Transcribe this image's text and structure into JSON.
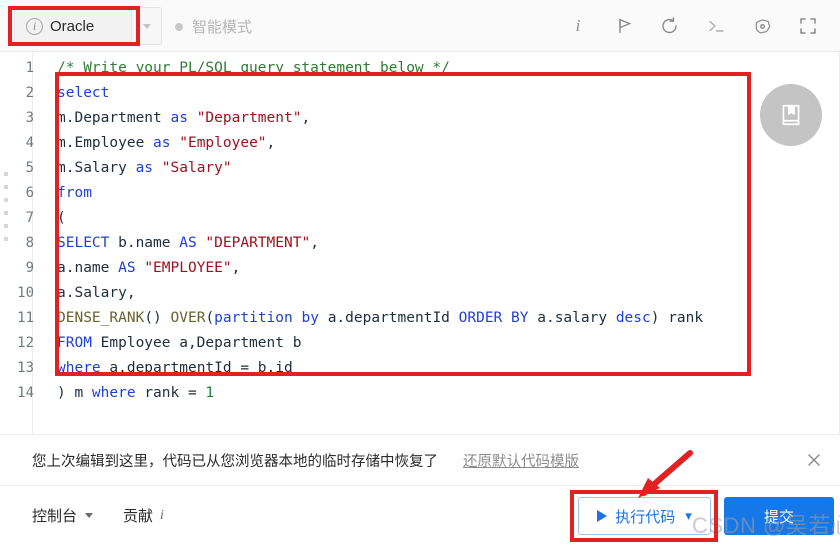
{
  "topbar": {
    "language_tab": {
      "label": "Oracle",
      "icon": "info-circle-icon"
    },
    "language_caret": "chevron-down-icon",
    "mode": {
      "label": "智能模式",
      "dot_color": "#c9c9c9"
    },
    "tools": [
      {
        "name": "info-icon",
        "glyph": "i"
      },
      {
        "name": "flag-icon",
        "glyph": "flag"
      },
      {
        "name": "reset-icon",
        "glyph": "undo"
      },
      {
        "name": "terminal-icon",
        "glyph": ">_"
      },
      {
        "name": "settings-icon",
        "glyph": "gear"
      },
      {
        "name": "fullscreen-icon",
        "glyph": "expand"
      }
    ]
  },
  "editor": {
    "save_button_icon": "book-bookmark-icon",
    "lines": [
      {
        "n": "1",
        "tokens": [
          {
            "t": "/* Write your PL/SQL query statement below */",
            "c": "cmt"
          }
        ]
      },
      {
        "n": "2",
        "tokens": [
          {
            "t": "select",
            "c": "kw"
          }
        ]
      },
      {
        "n": "3",
        "tokens": [
          {
            "t": "m.Department ",
            "c": ""
          },
          {
            "t": "as ",
            "c": "kw"
          },
          {
            "t": "\"Department\"",
            "c": "str"
          },
          {
            "t": ",",
            "c": ""
          }
        ]
      },
      {
        "n": "4",
        "tokens": [
          {
            "t": "m.Employee ",
            "c": ""
          },
          {
            "t": "as ",
            "c": "kw"
          },
          {
            "t": "\"Employee\"",
            "c": "str"
          },
          {
            "t": ",",
            "c": ""
          }
        ]
      },
      {
        "n": "5",
        "tokens": [
          {
            "t": "m.Salary ",
            "c": ""
          },
          {
            "t": "as ",
            "c": "kw"
          },
          {
            "t": "\"Salary\"",
            "c": "str"
          }
        ]
      },
      {
        "n": "6",
        "tokens": [
          {
            "t": "from",
            "c": "kw"
          }
        ]
      },
      {
        "n": "7",
        "tokens": [
          {
            "t": "(",
            "c": ""
          }
        ]
      },
      {
        "n": "8",
        "tokens": [
          {
            "t": "SELECT ",
            "c": "kw"
          },
          {
            "t": "b.name ",
            "c": ""
          },
          {
            "t": "AS ",
            "c": "kw"
          },
          {
            "t": "\"DEPARTMENT\"",
            "c": "str"
          },
          {
            "t": ",",
            "c": ""
          }
        ]
      },
      {
        "n": "9",
        "tokens": [
          {
            "t": "a.name ",
            "c": ""
          },
          {
            "t": "AS ",
            "c": "kw"
          },
          {
            "t": "\"EMPLOYEE\"",
            "c": "str"
          },
          {
            "t": ",",
            "c": ""
          }
        ]
      },
      {
        "n": "10",
        "tokens": [
          {
            "t": "a.Salary,",
            "c": ""
          }
        ]
      },
      {
        "n": "11",
        "tokens": [
          {
            "t": "DENSE_RANK",
            "c": "fn"
          },
          {
            "t": "() ",
            "c": ""
          },
          {
            "t": "OVER",
            "c": "fn"
          },
          {
            "t": "(",
            "c": ""
          },
          {
            "t": "partition ",
            "c": "kw"
          },
          {
            "t": "by ",
            "c": "kw"
          },
          {
            "t": "a.departmentId ",
            "c": ""
          },
          {
            "t": "ORDER ",
            "c": "kw"
          },
          {
            "t": "BY ",
            "c": "kw"
          },
          {
            "t": "a.salary ",
            "c": ""
          },
          {
            "t": "desc",
            "c": "kw"
          },
          {
            "t": ") rank",
            "c": ""
          }
        ]
      },
      {
        "n": "12",
        "tokens": [
          {
            "t": "FROM ",
            "c": "kw"
          },
          {
            "t": "Employee a,Department b",
            "c": ""
          }
        ]
      },
      {
        "n": "13",
        "tokens": [
          {
            "t": "where ",
            "c": "kw"
          },
          {
            "t": "a.departmentId = b.id",
            "c": ""
          }
        ]
      },
      {
        "n": "14",
        "tokens": [
          {
            "t": ") m ",
            "c": ""
          },
          {
            "t": "where ",
            "c": "kw"
          },
          {
            "t": "rank = ",
            "c": ""
          },
          {
            "t": "1",
            "c": "num"
          }
        ]
      }
    ]
  },
  "notice": {
    "message": "您上次编辑到这里，代码已从您浏览器本地的临时存储中恢复了",
    "link": "还原默认代码模版",
    "close_icon": "close-icon"
  },
  "bottombar": {
    "console": {
      "label": "控制台",
      "caret": "chevron-down-icon"
    },
    "contribute": {
      "label": "贡献",
      "icon": "info-icon",
      "glyph": "i"
    },
    "run_button": {
      "label": "执行代码",
      "play_icon": "play-icon",
      "caret": "chevron-down-icon"
    },
    "submit_button": {
      "label": "提交"
    }
  },
  "watermark": {
    "text": "CSDN @吴若心"
  },
  "annotation": {
    "color": "#e22222"
  }
}
